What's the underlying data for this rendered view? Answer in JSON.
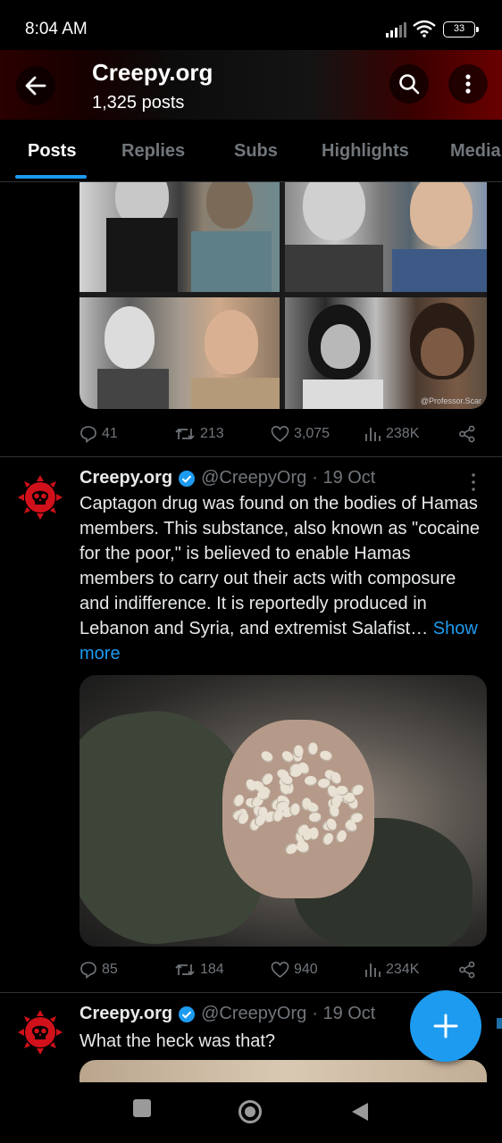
{
  "status_bar": {
    "time": "8:04 AM",
    "battery": "33"
  },
  "header": {
    "title": "Creepy.org",
    "post_count": "1,325 posts"
  },
  "tabs": [
    {
      "label": "Posts",
      "active": true
    },
    {
      "label": "Replies",
      "active": false
    },
    {
      "label": "Subs",
      "active": false
    },
    {
      "label": "Highlights",
      "active": false
    },
    {
      "label": "Media",
      "active": false
    }
  ],
  "posts": [
    {
      "image": {
        "watermark": "@Professor.Scar"
      },
      "stats": {
        "replies": "41",
        "reposts": "213",
        "likes": "3,075",
        "views": "238K"
      }
    },
    {
      "author": "Creepy.org",
      "handle": "@CreepyOrg",
      "date": "· 19 Oct",
      "text": "Captagon drug was found on the bodies of Hamas members. This substance, also known as \"cocaine for the poor,\" is believed to enable Hamas members to carry out their acts with composure and indifference. It is reportedly produced in Lebanon and Syria, and extremist Salafist…",
      "show_more": "Show more",
      "stats": {
        "replies": "85",
        "reposts": "184",
        "likes": "940",
        "views": "234K"
      }
    },
    {
      "author": "Creepy.org",
      "handle": "@CreepyOrg",
      "date": "· 19 Oct",
      "text": "What the heck was that?"
    }
  ],
  "colors": {
    "accent": "#1d9bf0",
    "muted": "#71767b",
    "avatar_red": "#d0101a"
  }
}
